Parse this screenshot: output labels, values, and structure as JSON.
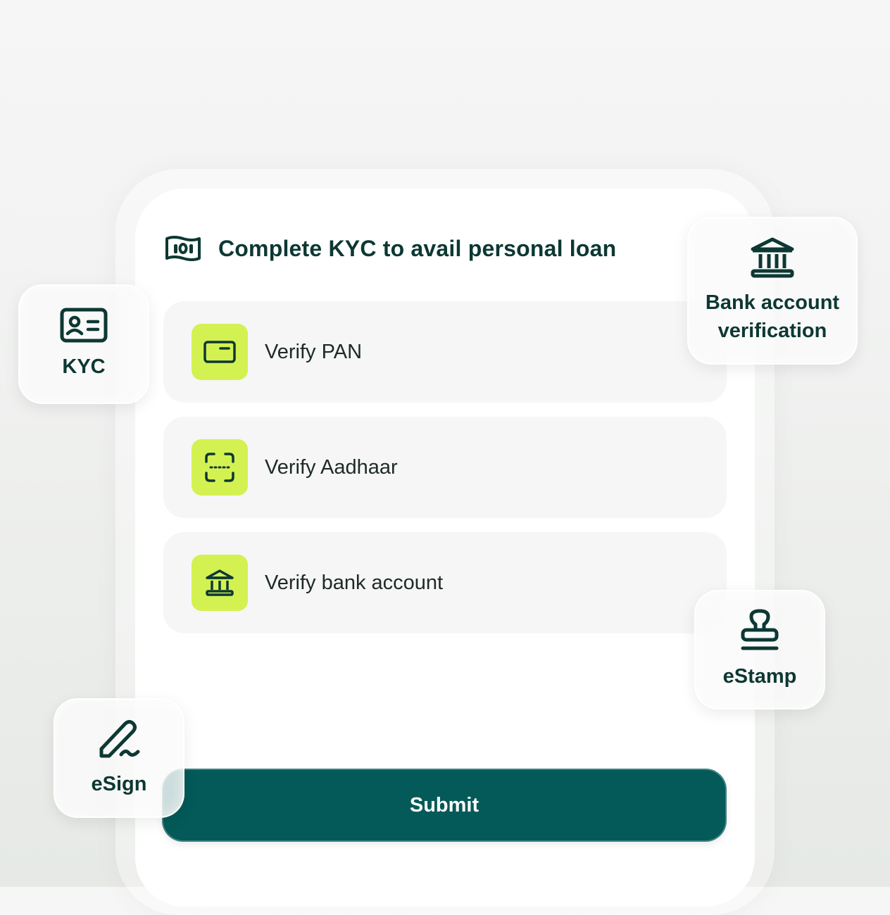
{
  "header": {
    "icon": "cash-note-icon",
    "title": "Complete KYC to avail personal loan"
  },
  "verifications": [
    {
      "icon": "pan-card-icon",
      "label": "Verify PAN"
    },
    {
      "icon": "scan-frame-icon",
      "label": "Verify Aadhaar"
    },
    {
      "icon": "bank-icon",
      "label": "Verify bank account"
    }
  ],
  "submit_label": "Submit",
  "feature_cards": {
    "kyc": {
      "icon": "id-card-icon",
      "label": "KYC"
    },
    "bank": {
      "icon": "bank-icon",
      "label_line1": "Bank account",
      "label_line2": "verification"
    },
    "estamp": {
      "icon": "stamp-icon",
      "label": "eStamp"
    },
    "esign": {
      "icon": "pen-signature-icon",
      "label": "eSign"
    }
  },
  "colors": {
    "accent_tile": "#d4f152",
    "primary_button": "#035a58",
    "text_dark": "#0d3833"
  }
}
